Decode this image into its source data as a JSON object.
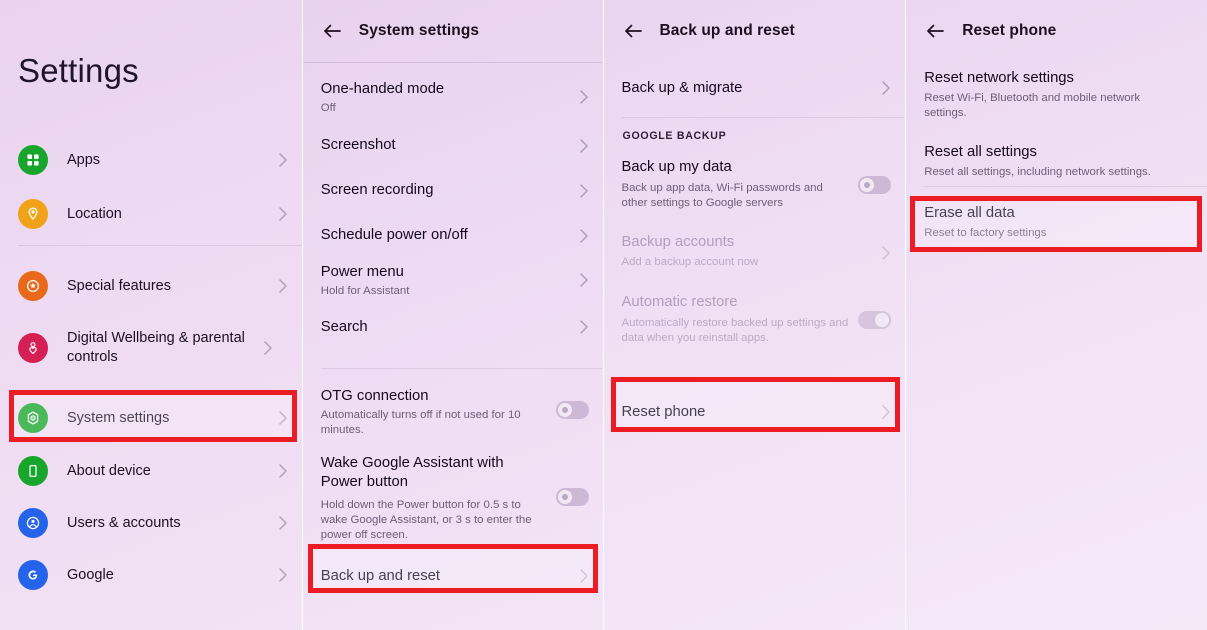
{
  "meta": {
    "flow": "Android factory reset walkthrough",
    "panel_count": 4,
    "highlight_color": "#ec1c24",
    "background_color": "#eedaf2"
  },
  "panel1": {
    "title": "Settings",
    "items": [
      {
        "label": "Apps",
        "icon": "apps-grid-icon",
        "icon_color": "#17a62b",
        "chevron": true
      },
      {
        "label": "Location",
        "icon": "location-pin-icon",
        "icon_color": "#f0a318",
        "chevron": true
      },
      {
        "label": "Special features",
        "icon": "special-features-star-icon",
        "icon_color": "#e8691c",
        "chevron": true
      },
      {
        "label": "Digital Wellbeing & parental controls",
        "icon": "digital-wellbeing-heart-icon",
        "icon_color": "#d61f52",
        "chevron": true
      },
      {
        "label": "System settings",
        "icon": "system-settings-gear-icon",
        "icon_color": "#17a62b",
        "chevron": true,
        "highlighted": true
      },
      {
        "label": "About device",
        "icon": "phone-device-icon",
        "icon_color": "#17a62b",
        "chevron": true
      },
      {
        "label": "Users & accounts",
        "icon": "user-account-icon",
        "icon_color": "#2563eb",
        "chevron": true
      },
      {
        "label": "Google",
        "icon": "google-g-icon",
        "icon_color": "#2563eb",
        "chevron": true
      }
    ]
  },
  "panel2": {
    "header": {
      "title": "System settings",
      "back_icon": "back-arrow-icon"
    },
    "items": [
      {
        "title": "One-handed mode",
        "sub": "Off",
        "chevron": true
      },
      {
        "title": "Screenshot",
        "sub": "",
        "chevron": true
      },
      {
        "title": "Screen recording",
        "sub": "",
        "chevron": true
      },
      {
        "title": "Schedule power on/off",
        "sub": "",
        "chevron": true
      },
      {
        "title": "Power menu",
        "sub": "Hold for Assistant",
        "chevron": true
      },
      {
        "title": "Search",
        "sub": "",
        "chevron": true
      }
    ],
    "items2": [
      {
        "title": "OTG connection",
        "sub": "Automatically turns off if not used for 10 minutes.",
        "toggle": "off"
      },
      {
        "title": "Wake Google Assistant with Power button",
        "sub": "Hold down the Power button for 0.5 s to wake Google Assistant, or 3 s to enter the power off screen.",
        "toggle": "off"
      }
    ],
    "highlighted_item": {
      "title": "Back up and reset",
      "chevron": true
    }
  },
  "panel3": {
    "header": {
      "title": "Back up and reset",
      "back_icon": "back-arrow-icon"
    },
    "top_item": {
      "title": "Back up & migrate",
      "chevron": true
    },
    "section_label": "GOOGLE BACKUP",
    "items": [
      {
        "title": "Back up my data",
        "sub": "Back up app data, Wi-Fi passwords and other settings to Google servers",
        "toggle": "off",
        "dim": false
      },
      {
        "title": "Backup accounts",
        "sub": "Add a backup account now",
        "chevron": true,
        "dim": true
      },
      {
        "title": "Automatic restore",
        "sub": "Automatically restore backed up settings and data when you reinstall apps.",
        "toggle": "on",
        "dim": true
      }
    ],
    "highlighted_item": {
      "title": "Reset phone",
      "chevron": true
    }
  },
  "panel4": {
    "header": {
      "title": "Reset phone",
      "back_icon": "back-arrow-icon"
    },
    "items": [
      {
        "title": "Reset network settings",
        "sub": "Reset Wi-Fi, Bluetooth and mobile network settings."
      },
      {
        "title": "Reset all settings",
        "sub": "Reset all settings, including network settings."
      }
    ],
    "highlighted_item": {
      "title": "Erase all data",
      "sub": "Reset to factory settings"
    }
  }
}
